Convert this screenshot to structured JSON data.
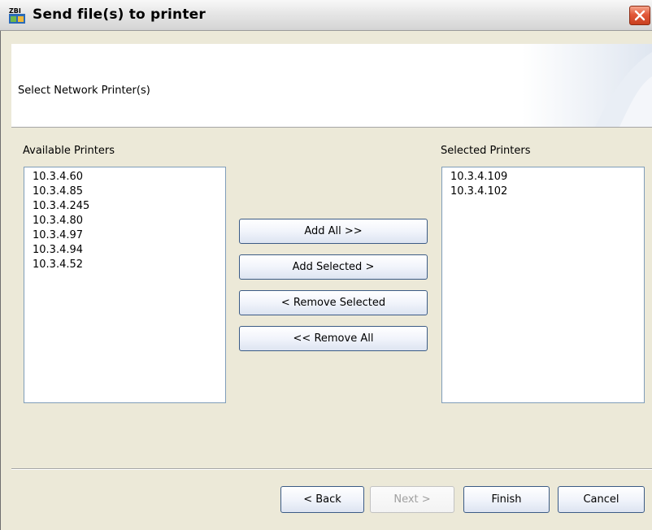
{
  "window": {
    "title": "Send file(s) to printer",
    "icon": "zbi-app-icon",
    "close_icon": "close-icon"
  },
  "header": {
    "instruction": "Select Network Printer(s)"
  },
  "available": {
    "label": "Available Printers",
    "items": [
      "10.3.4.60",
      "10.3.4.85",
      "10.3.4.245",
      "10.3.4.80",
      "10.3.4.97",
      "10.3.4.94",
      "10.3.4.52"
    ]
  },
  "selected": {
    "label": "Selected Printers",
    "items": [
      "10.3.4.109",
      "10.3.4.102"
    ]
  },
  "transfer_buttons": {
    "add_all": "Add All >>",
    "add_selected": "Add Selected >",
    "remove_selected": "< Remove Selected",
    "remove_all": "<< Remove All"
  },
  "footer": {
    "back": "< Back",
    "next": "Next >",
    "finish": "Finish",
    "cancel": "Cancel"
  },
  "colors": {
    "accent": "#3b5b85",
    "close": "#e2583a",
    "background": "#ece9d8"
  }
}
